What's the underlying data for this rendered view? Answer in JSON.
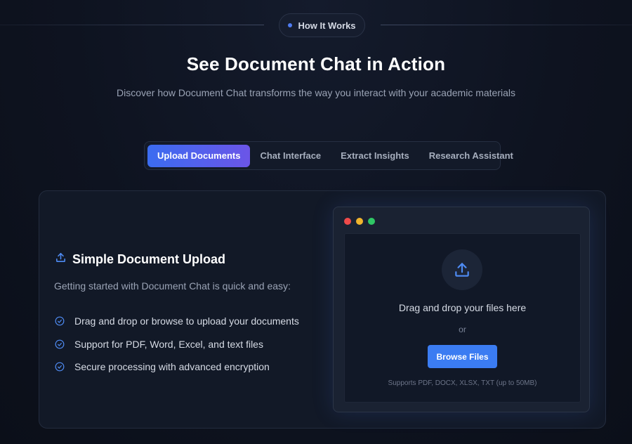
{
  "header": {
    "badge_label": "How It Works",
    "title": "See Document Chat in Action",
    "subtitle": "Discover how Document Chat transforms the way you interact with your academic materials"
  },
  "tabs": [
    {
      "label": "Upload Documents",
      "active": true
    },
    {
      "label": "Chat Interface",
      "active": false
    },
    {
      "label": "Extract Insights",
      "active": false
    },
    {
      "label": "Research Assistant",
      "active": false
    }
  ],
  "feature": {
    "icon": "upload-icon",
    "title": "Simple Document Upload",
    "description": "Getting started with Document Chat is quick and easy:",
    "items": [
      "Drag and drop or browse to upload your documents",
      "Support for PDF, Word, Excel, and text files",
      "Secure processing with advanced encryption"
    ]
  },
  "upload_window": {
    "main_text": "Drag and drop your files here",
    "or_text": "or",
    "button_label": "Browse Files",
    "support_text": "Supports PDF, DOCX, XLSX, TXT (up to 50MB)"
  },
  "colors": {
    "accent": "#3b7cf2",
    "background": "#0e1320",
    "card": "#121927"
  }
}
